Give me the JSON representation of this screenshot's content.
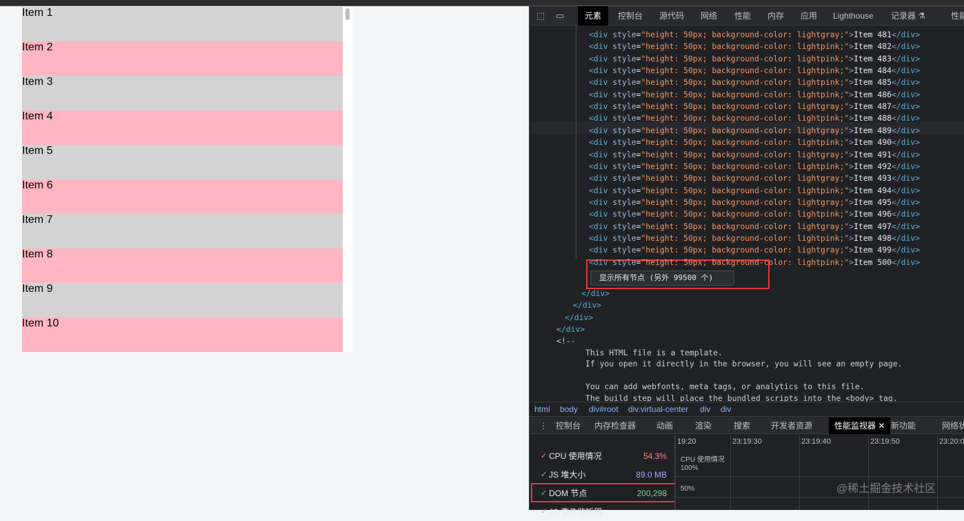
{
  "list": {
    "items": [
      {
        "label": "Item 1",
        "color": "gray"
      },
      {
        "label": "Item 2",
        "color": "pink"
      },
      {
        "label": "Item 3",
        "color": "gray"
      },
      {
        "label": "Item 4",
        "color": "pink"
      },
      {
        "label": "Item 5",
        "color": "gray"
      },
      {
        "label": "Item 6",
        "color": "pink"
      },
      {
        "label": "Item 7",
        "color": "gray"
      },
      {
        "label": "Item 8",
        "color": "pink"
      },
      {
        "label": "Item 9",
        "color": "gray"
      },
      {
        "label": "Item 10",
        "color": "pink"
      }
    ],
    "colors": {
      "gray": "#d3d3d3",
      "pink": "#ffb6c1"
    }
  },
  "devtools": {
    "tabs": [
      "元素",
      "控制台",
      "源代码",
      "网络",
      "性能",
      "内存",
      "应用",
      "Lighthouse",
      "记录器 ⚗",
      "性能"
    ],
    "icons": [
      "inspect-icon",
      "device-toggle-icon"
    ],
    "rows": [
      {
        "num": "481",
        "color": "lightgray"
      },
      {
        "num": "482",
        "color": "lightpink"
      },
      {
        "num": "483",
        "color": "lightpink"
      },
      {
        "num": "484",
        "color": "lightpink"
      },
      {
        "num": "485",
        "color": "lightpink"
      },
      {
        "num": "486",
        "color": "lightpink"
      },
      {
        "num": "487",
        "color": "lightgray"
      },
      {
        "num": "488",
        "color": "lightpink"
      },
      {
        "num": "489",
        "color": "lightgray"
      },
      {
        "num": "490",
        "color": "lightpink"
      },
      {
        "num": "491",
        "color": "lightgray"
      },
      {
        "num": "492",
        "color": "lightpink"
      },
      {
        "num": "493",
        "color": "lightgray"
      },
      {
        "num": "494",
        "color": "lightpink"
      },
      {
        "num": "495",
        "color": "lightgray"
      },
      {
        "num": "496",
        "color": "lightpink"
      },
      {
        "num": "497",
        "color": "lightgray"
      },
      {
        "num": "498",
        "color": "lightpink"
      },
      {
        "num": "499",
        "color": "lightgray"
      },
      {
        "num": "500",
        "color": "lightpink"
      }
    ],
    "row_style_prefix": "height: 50px; background-color: ",
    "show_all_button": "显示所有节点 (另外 99500 个)",
    "closing_tags": [
      "</div>",
      "</div>",
      "</div>",
      "</div>"
    ],
    "comment_open": "<!--",
    "comment_lines": [
      "This HTML file is a template.",
      "If you open it directly in the browser, you will see an empty page.",
      "",
      "You can add webfonts, meta tags, or analytics to this file.",
      "The build step will place the bundled scripts into the <body> tag."
    ],
    "breadcrumbs": [
      "html",
      "body",
      "div#root",
      "div.virtual-center",
      "div",
      "div"
    ],
    "drawer_tabs": [
      "控制台",
      "内存检查器",
      "动画",
      "渲染",
      "搜索",
      "开发者资源",
      "性能监视器",
      "新功能",
      "网络状"
    ],
    "drawer_active": "性能监视器",
    "metrics": [
      {
        "label": "CPU 使用情况",
        "value": "54.3%",
        "color": "#f28b82"
      },
      {
        "label": "JS 堆大小",
        "value": "89.0 MB",
        "color": "#a8a0f8"
      },
      {
        "label": "DOM 节点",
        "value": "200,298",
        "color": "#81c995"
      },
      {
        "label": "JS 事件监听器",
        "value": "",
        "color": "#bdc1c6"
      }
    ],
    "chart": {
      "times": [
        "19:20",
        "23:19:30",
        "23:19:40",
        "23:19:50",
        "23:20:0"
      ],
      "title": "CPU 使用情况",
      "levels": [
        "100%",
        "50%"
      ]
    }
  },
  "watermark": "@稀土掘金技术社区"
}
